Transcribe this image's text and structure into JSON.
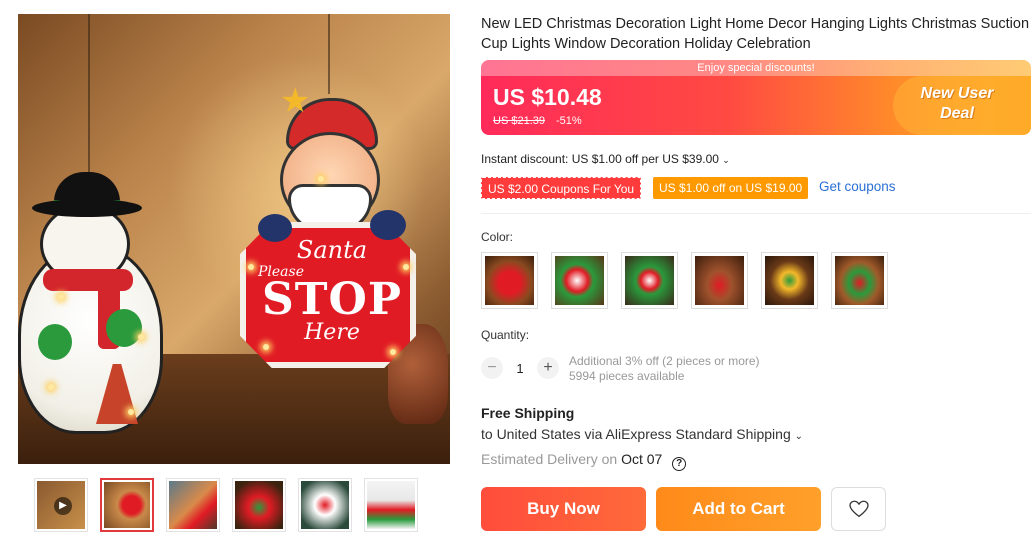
{
  "product": {
    "title": "New LED Christmas Decoration Light Home Decor Hanging Lights Christmas Suction Cup Lights Window Decoration Holiday Celebration"
  },
  "main_image": {
    "sign_santa": "Santa",
    "sign_please": "Please",
    "sign_stop": "STOP",
    "sign_here": "Here"
  },
  "price": {
    "banner_text": "Enjoy special discounts!",
    "current": "US $10.48",
    "original": "US $21.39",
    "discount": "-51%",
    "promo_line1": "New User",
    "promo_line2": "Deal"
  },
  "discounts": {
    "instant": "Instant discount: US $1.00 off per US $39.00",
    "coupon1": "US $2.00 Coupons For You",
    "coupon2": "US $1.00 off on US $19.00",
    "get_coupons": "Get coupons"
  },
  "color": {
    "label": "Color:",
    "options": [
      "stop-sign-santa",
      "santa-snowman",
      "snowman",
      "reindeer-sleigh",
      "christmas-tree",
      "santa-sleigh"
    ]
  },
  "quantity": {
    "label": "Quantity:",
    "minus": "−",
    "value": "1",
    "plus": "+",
    "note_line1": "Additional 3% off (2 pieces or more)",
    "note_line2": "5994 pieces available"
  },
  "shipping": {
    "title": "Free Shipping",
    "line": "to United States via AliExpress Standard Shipping",
    "delivery_prefix": "Estimated Delivery on",
    "delivery_date": "Oct 07",
    "help": "?"
  },
  "actions": {
    "buy_now": "Buy Now",
    "add_to_cart": "Add to Cart"
  },
  "colors": {
    "accent": "#ff4d3b",
    "cart": "#ff9900",
    "link": "#2a6fd6"
  }
}
